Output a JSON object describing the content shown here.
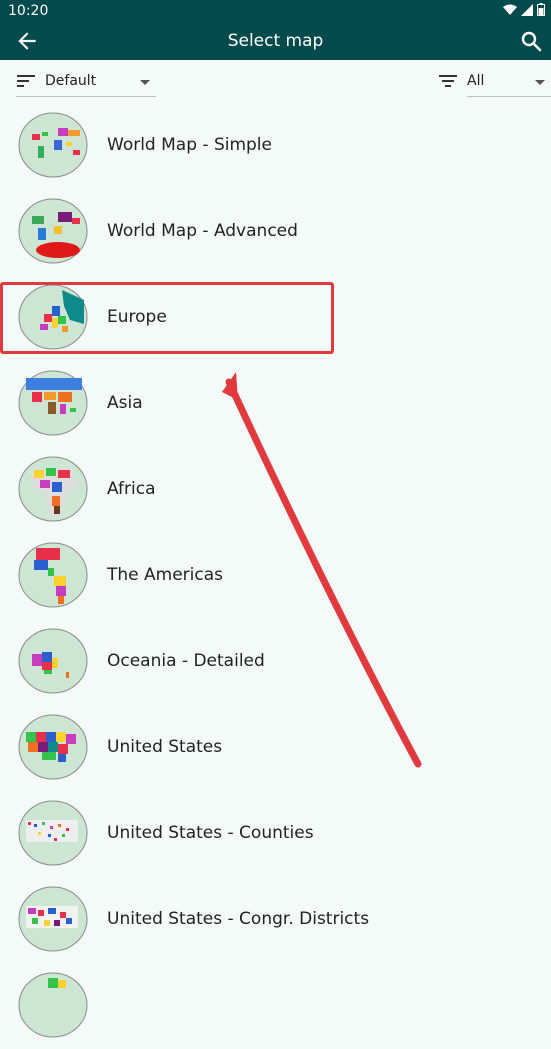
{
  "status": {
    "time": "10:20"
  },
  "appbar": {
    "title": "Select map"
  },
  "filters": {
    "sort_value": "Default",
    "filter_value": "All"
  },
  "maps": [
    {
      "label": "World Map - Simple"
    },
    {
      "label": "World Map - Advanced"
    },
    {
      "label": "Europe"
    },
    {
      "label": "Asia"
    },
    {
      "label": "Africa"
    },
    {
      "label": "The Americas"
    },
    {
      "label": "Oceania - Detailed"
    },
    {
      "label": "United States"
    },
    {
      "label": "United States - Counties"
    },
    {
      "label": "United States - Congr. Districts"
    }
  ],
  "annotation": {
    "highlighted_item": "Europe",
    "color": "#e03a3e"
  }
}
